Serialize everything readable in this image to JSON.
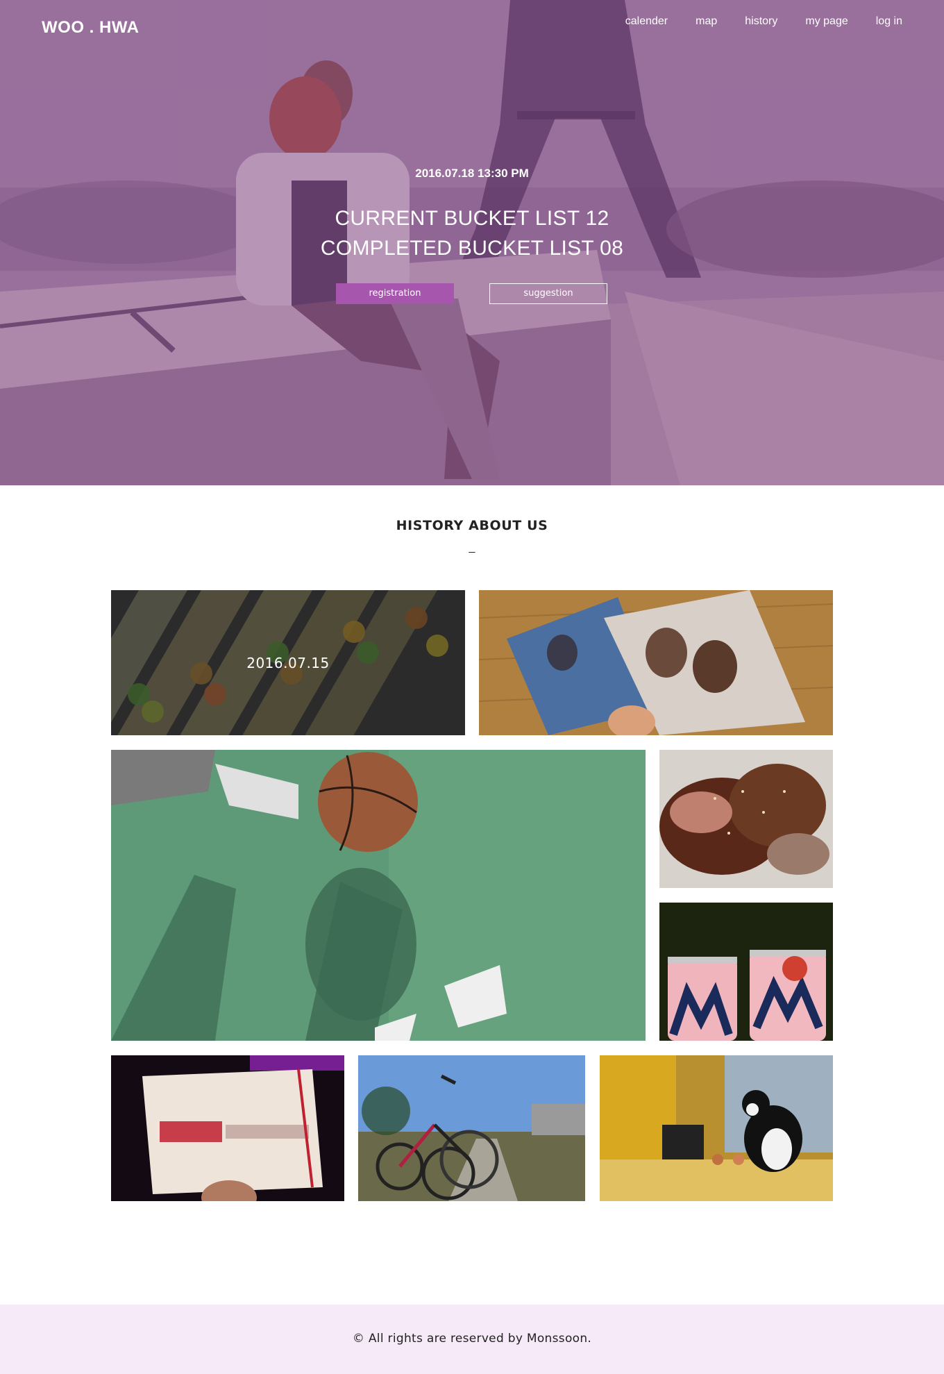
{
  "brand": {
    "logo": "WOO . HWA",
    "accent": "#a657ad",
    "overlay": "#70327a"
  },
  "nav": {
    "items": [
      {
        "label": "calender"
      },
      {
        "label": "map"
      },
      {
        "label": "history"
      },
      {
        "label": "my page"
      },
      {
        "label": "log in"
      }
    ]
  },
  "hero": {
    "datetime": "2016.07.18 13:30 PM",
    "current_line": "CURRENT BUCKET LIST 12",
    "completed_line": "COMPLETED BUCKET LIST 08",
    "registration_label": "registration",
    "suggestion_label": "suggestion"
  },
  "history": {
    "title": "HISTORY ABOUT US",
    "divider": "_",
    "tiles": [
      {
        "name": "macarons-photo",
        "caption": "2016.07.15"
      },
      {
        "name": "photo-cards-photo"
      },
      {
        "name": "basketball-court-photo"
      },
      {
        "name": "braised-pork-photo"
      },
      {
        "name": "max-beer-cans-photo"
      },
      {
        "name": "love-actually-ticket-photo"
      },
      {
        "name": "bicycles-photo"
      },
      {
        "name": "cat-on-windowsill-photo"
      }
    ]
  },
  "footer": {
    "copyright": "© All rights are reserved by Monssoon."
  }
}
